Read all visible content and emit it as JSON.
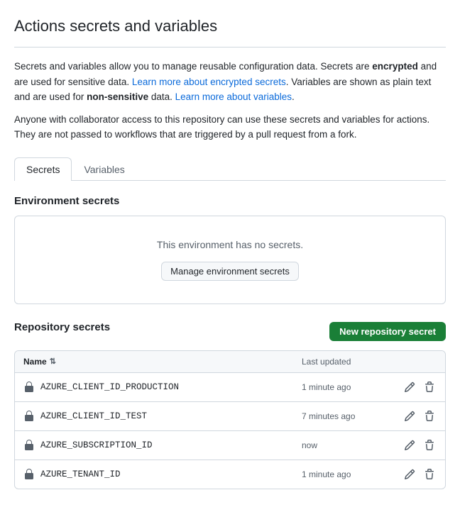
{
  "page": {
    "title": "Actions secrets and variables"
  },
  "description": {
    "line1_pre": "Secrets and variables allow you to manage reusable configuration data. Secrets are ",
    "line1_bold": "encrypted",
    "line1_mid": " and are used for sensitive data. ",
    "line1_link1": "Learn more about encrypted secrets",
    "line1_link1_href": "#",
    "line1_post": ". Variables are shown as plain text and are used for ",
    "line1_bold2": "non-sensitive",
    "line1_post2": " data. ",
    "line1_link2": "Learn more about variables",
    "line1_link2_href": "#",
    "line2": "Anyone with collaborator access to this repository can use these secrets and variables for actions. They are not passed to workflows that are triggered by a pull request from a fork."
  },
  "tabs": {
    "secrets": "Secrets",
    "variables": "Variables"
  },
  "environment_secrets": {
    "title": "Environment secrets",
    "empty_message": "This environment has no secrets.",
    "manage_btn": "Manage environment secrets"
  },
  "repository_secrets": {
    "title": "Repository secrets",
    "new_btn": "New repository secret",
    "table": {
      "col_name": "Name",
      "col_sort_icon": "⇅",
      "col_updated": "Last updated",
      "rows": [
        {
          "name": "AZURE_CLIENT_ID_PRODUCTION",
          "updated": "1 minute ago"
        },
        {
          "name": "AZURE_CLIENT_ID_TEST",
          "updated": "7 minutes ago"
        },
        {
          "name": "AZURE_SUBSCRIPTION_ID",
          "updated": "now"
        },
        {
          "name": "AZURE_TENANT_ID",
          "updated": "1 minute ago"
        }
      ]
    }
  }
}
